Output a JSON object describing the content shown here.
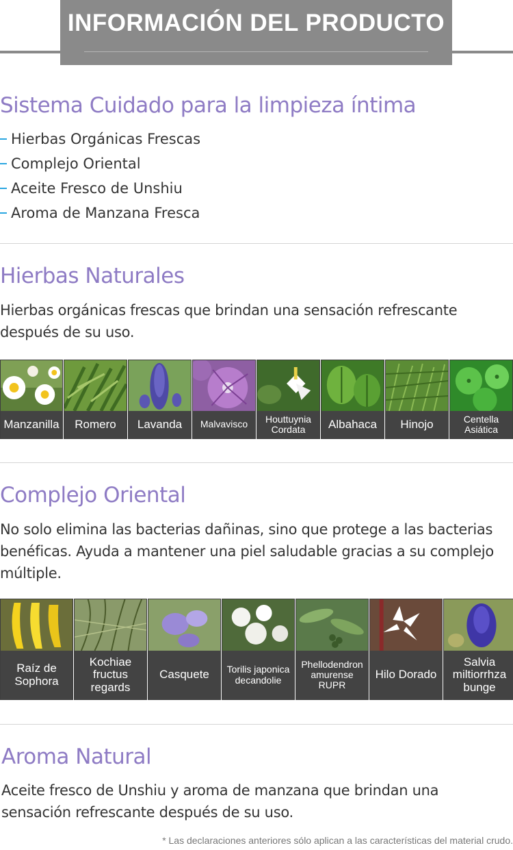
{
  "header": {
    "title": "INFORMACIÓN DEL PRODUCTO"
  },
  "system": {
    "title": "Sistema Cuidado para la limpieza íntima",
    "features": [
      "Hierbas Orgánicas Frescas",
      "Complejo Oriental",
      "Aceite Fresco de Unshiu",
      "Aroma de Manzana Fresca"
    ]
  },
  "herbs": {
    "title": "Hierbas Naturales",
    "description": "Hierbas orgánicas frescas que brindan una sensación refrescante después de su uso.",
    "items": [
      {
        "label": "Manzanilla",
        "image": "chamomile-photo"
      },
      {
        "label": "Romero",
        "image": "rosemary-photo"
      },
      {
        "label": "Lavanda",
        "image": "lavender-photo"
      },
      {
        "label": "Malvavisco",
        "image": "mallow-photo"
      },
      {
        "label": "Houttuynia Cordata",
        "image": "houttuynia-photo"
      },
      {
        "label": "Albahaca",
        "image": "basil-photo"
      },
      {
        "label": "Hinojo",
        "image": "fennel-photo"
      },
      {
        "label": "Centella Asiática",
        "image": "centella-photo"
      }
    ]
  },
  "complex": {
    "title": "Complejo Oriental",
    "description": "No solo elimina las bacterias dañinas, sino que protege a las bacterias benéficas. Ayuda a mantener una piel saludable gracias a su complejo múltiple.",
    "items": [
      {
        "label": "Raíz de Sophora",
        "image": "sophora-photo"
      },
      {
        "label": "Kochiae fructus regards",
        "image": "kochia-photo"
      },
      {
        "label": "Casquete",
        "image": "skullcap-photo"
      },
      {
        "label": "Torilis japonica decandolie",
        "image": "torilis-photo"
      },
      {
        "label": "Phellodendron amurense RUPR",
        "image": "phellodendron-photo"
      },
      {
        "label": "Hilo Dorado",
        "image": "golden-thread-photo"
      },
      {
        "label": "Salvia miltiorrhza bunge",
        "image": "salvia-photo"
      }
    ]
  },
  "aroma": {
    "title": "Aroma Natural",
    "description": "Aceite fresco de Unshiu y aroma de manzana que brindan una sensación refrescante después de su uso."
  },
  "footnote": "* Las declaraciones anteriores sólo aplican a las características del material crudo.",
  "colors": {
    "heading": "#8e7bc4",
    "bullet": "#29a6e0",
    "banner": "#8a8a8a",
    "label_bg": "#434343"
  }
}
